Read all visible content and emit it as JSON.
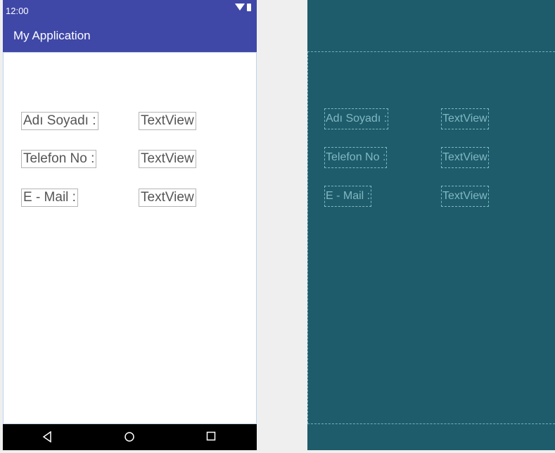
{
  "status_bar": {
    "time": "12:00"
  },
  "app_bar": {
    "title": "My Application"
  },
  "form": {
    "rows": [
      {
        "label": "Adı Soyadı :",
        "value": "TextView"
      },
      {
        "label": "Telefon No  :",
        "value": "TextView"
      },
      {
        "label": "E - Mail :",
        "value": "TextView"
      }
    ]
  },
  "blueprint": {
    "rows": [
      {
        "label": "Adı Soyadı :",
        "value": "TextView"
      },
      {
        "label": "Telefon No  :",
        "value": "TextView"
      },
      {
        "label": "E - Mail :",
        "value": "TextView"
      }
    ]
  },
  "icons": {
    "wifi": "wifi-icon",
    "battery": "battery-icon",
    "back": "back-triangle-icon",
    "home": "home-circle-icon",
    "recents": "recents-square-icon"
  },
  "colors": {
    "primary": "#3f48a7",
    "blueprint_bg": "#1e5c6b",
    "blueprint_line": "#7fb8c3",
    "navbar": "#000000"
  }
}
